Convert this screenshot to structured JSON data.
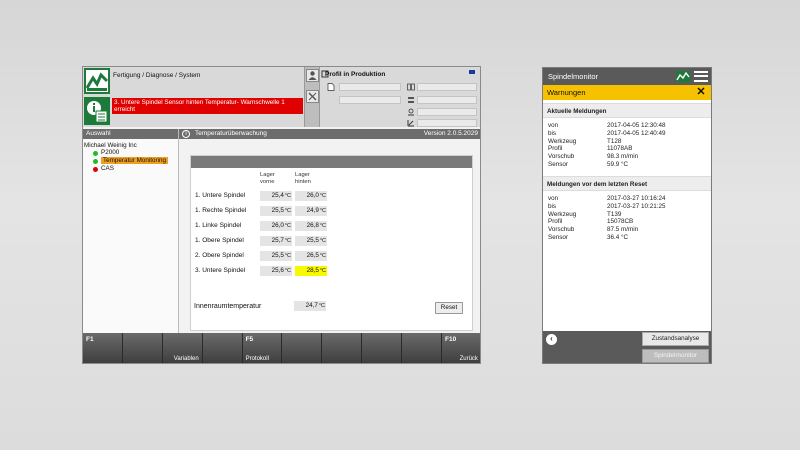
{
  "hmi": {
    "breadcrumb": "Fertigung / Diagnose / System",
    "alarm_text": "3. Untere Spindel Sensor hinten Temperatur- Warnschwelle 1 erreicht",
    "profile_title": "Profil in Produktion",
    "selection": {
      "title": "Auswahl",
      "root": "Michael Weinig Inc",
      "items": [
        {
          "label": "P2000",
          "status_color": "#22bb22",
          "selected": false
        },
        {
          "label": "Temperatur Monitoring",
          "status_color": "#22bb22",
          "selected": true
        },
        {
          "label": "CAS",
          "status_color": "#e00000",
          "selected": false
        }
      ]
    },
    "main": {
      "title": "Temperaturüberwachung",
      "version": "Version 2.0.5.2029",
      "col_front": "Lager vorne",
      "col_back": "Lager hinten",
      "unit": "°C",
      "rows": [
        {
          "label": "1. Untere Spindel",
          "front": "25,4",
          "back": "26,0",
          "warn": false
        },
        {
          "label": "1. Rechte Spindel",
          "front": "25,5",
          "back": "24,9",
          "warn": false
        },
        {
          "label": "1. Linke Spindel",
          "front": "26,0",
          "back": "26,8",
          "warn": false
        },
        {
          "label": "1. Obere Spindel",
          "front": "25,7",
          "back": "25,5",
          "warn": false
        },
        {
          "label": "2. Obere Spindel",
          "front": "25,5",
          "back": "26,5",
          "warn": false
        },
        {
          "label": "3. Untere Spindel",
          "front": "25,6",
          "back": "28,5",
          "warn": true
        }
      ],
      "innen_label": "Innenraumtemperatur",
      "innen_value": "24,7",
      "reset_label": "Reset"
    },
    "fkeys": [
      {
        "num": "F1",
        "label": ""
      },
      {
        "num": "",
        "label": ""
      },
      {
        "num": "",
        "label": "Variablen"
      },
      {
        "num": "",
        "label": ""
      },
      {
        "num": "F5",
        "label": "Protokoll"
      },
      {
        "num": "",
        "label": ""
      },
      {
        "num": "",
        "label": ""
      },
      {
        "num": "",
        "label": ""
      },
      {
        "num": "",
        "label": ""
      },
      {
        "num": "F10",
        "label": "Zurück"
      }
    ]
  },
  "phone": {
    "app_title": "Spindelmonitor",
    "warn_title": "Warnungen",
    "current_title": "Aktuelle Meldungen",
    "current": [
      {
        "k": "von",
        "v": "2017-04-05 12:30:48"
      },
      {
        "k": "bis",
        "v": "2017-04-05 12:40:49"
      },
      {
        "k": "Werkzeug",
        "v": "T128"
      },
      {
        "k": "Profil",
        "v": "11078AB"
      },
      {
        "k": "Vorschub",
        "v": "98.3 m/min"
      },
      {
        "k": "Sensor",
        "v": "59.9 °C"
      }
    ],
    "previous_title": "Meldungen vor dem letzten Reset",
    "previous": [
      {
        "k": "von",
        "v": "2017-03-27 10:16:24"
      },
      {
        "k": "bis",
        "v": "2017-03-27 10:21:25"
      },
      {
        "k": "Werkzeug",
        "v": "T139"
      },
      {
        "k": "Profil",
        "v": "15078CB"
      },
      {
        "k": "Vorschub",
        "v": "87.5 m/min"
      },
      {
        "k": "Sensor",
        "v": "36.4 °C"
      }
    ],
    "btn_state": "Zustandsanalyse",
    "btn_monitor": "Spindelmonitor"
  }
}
